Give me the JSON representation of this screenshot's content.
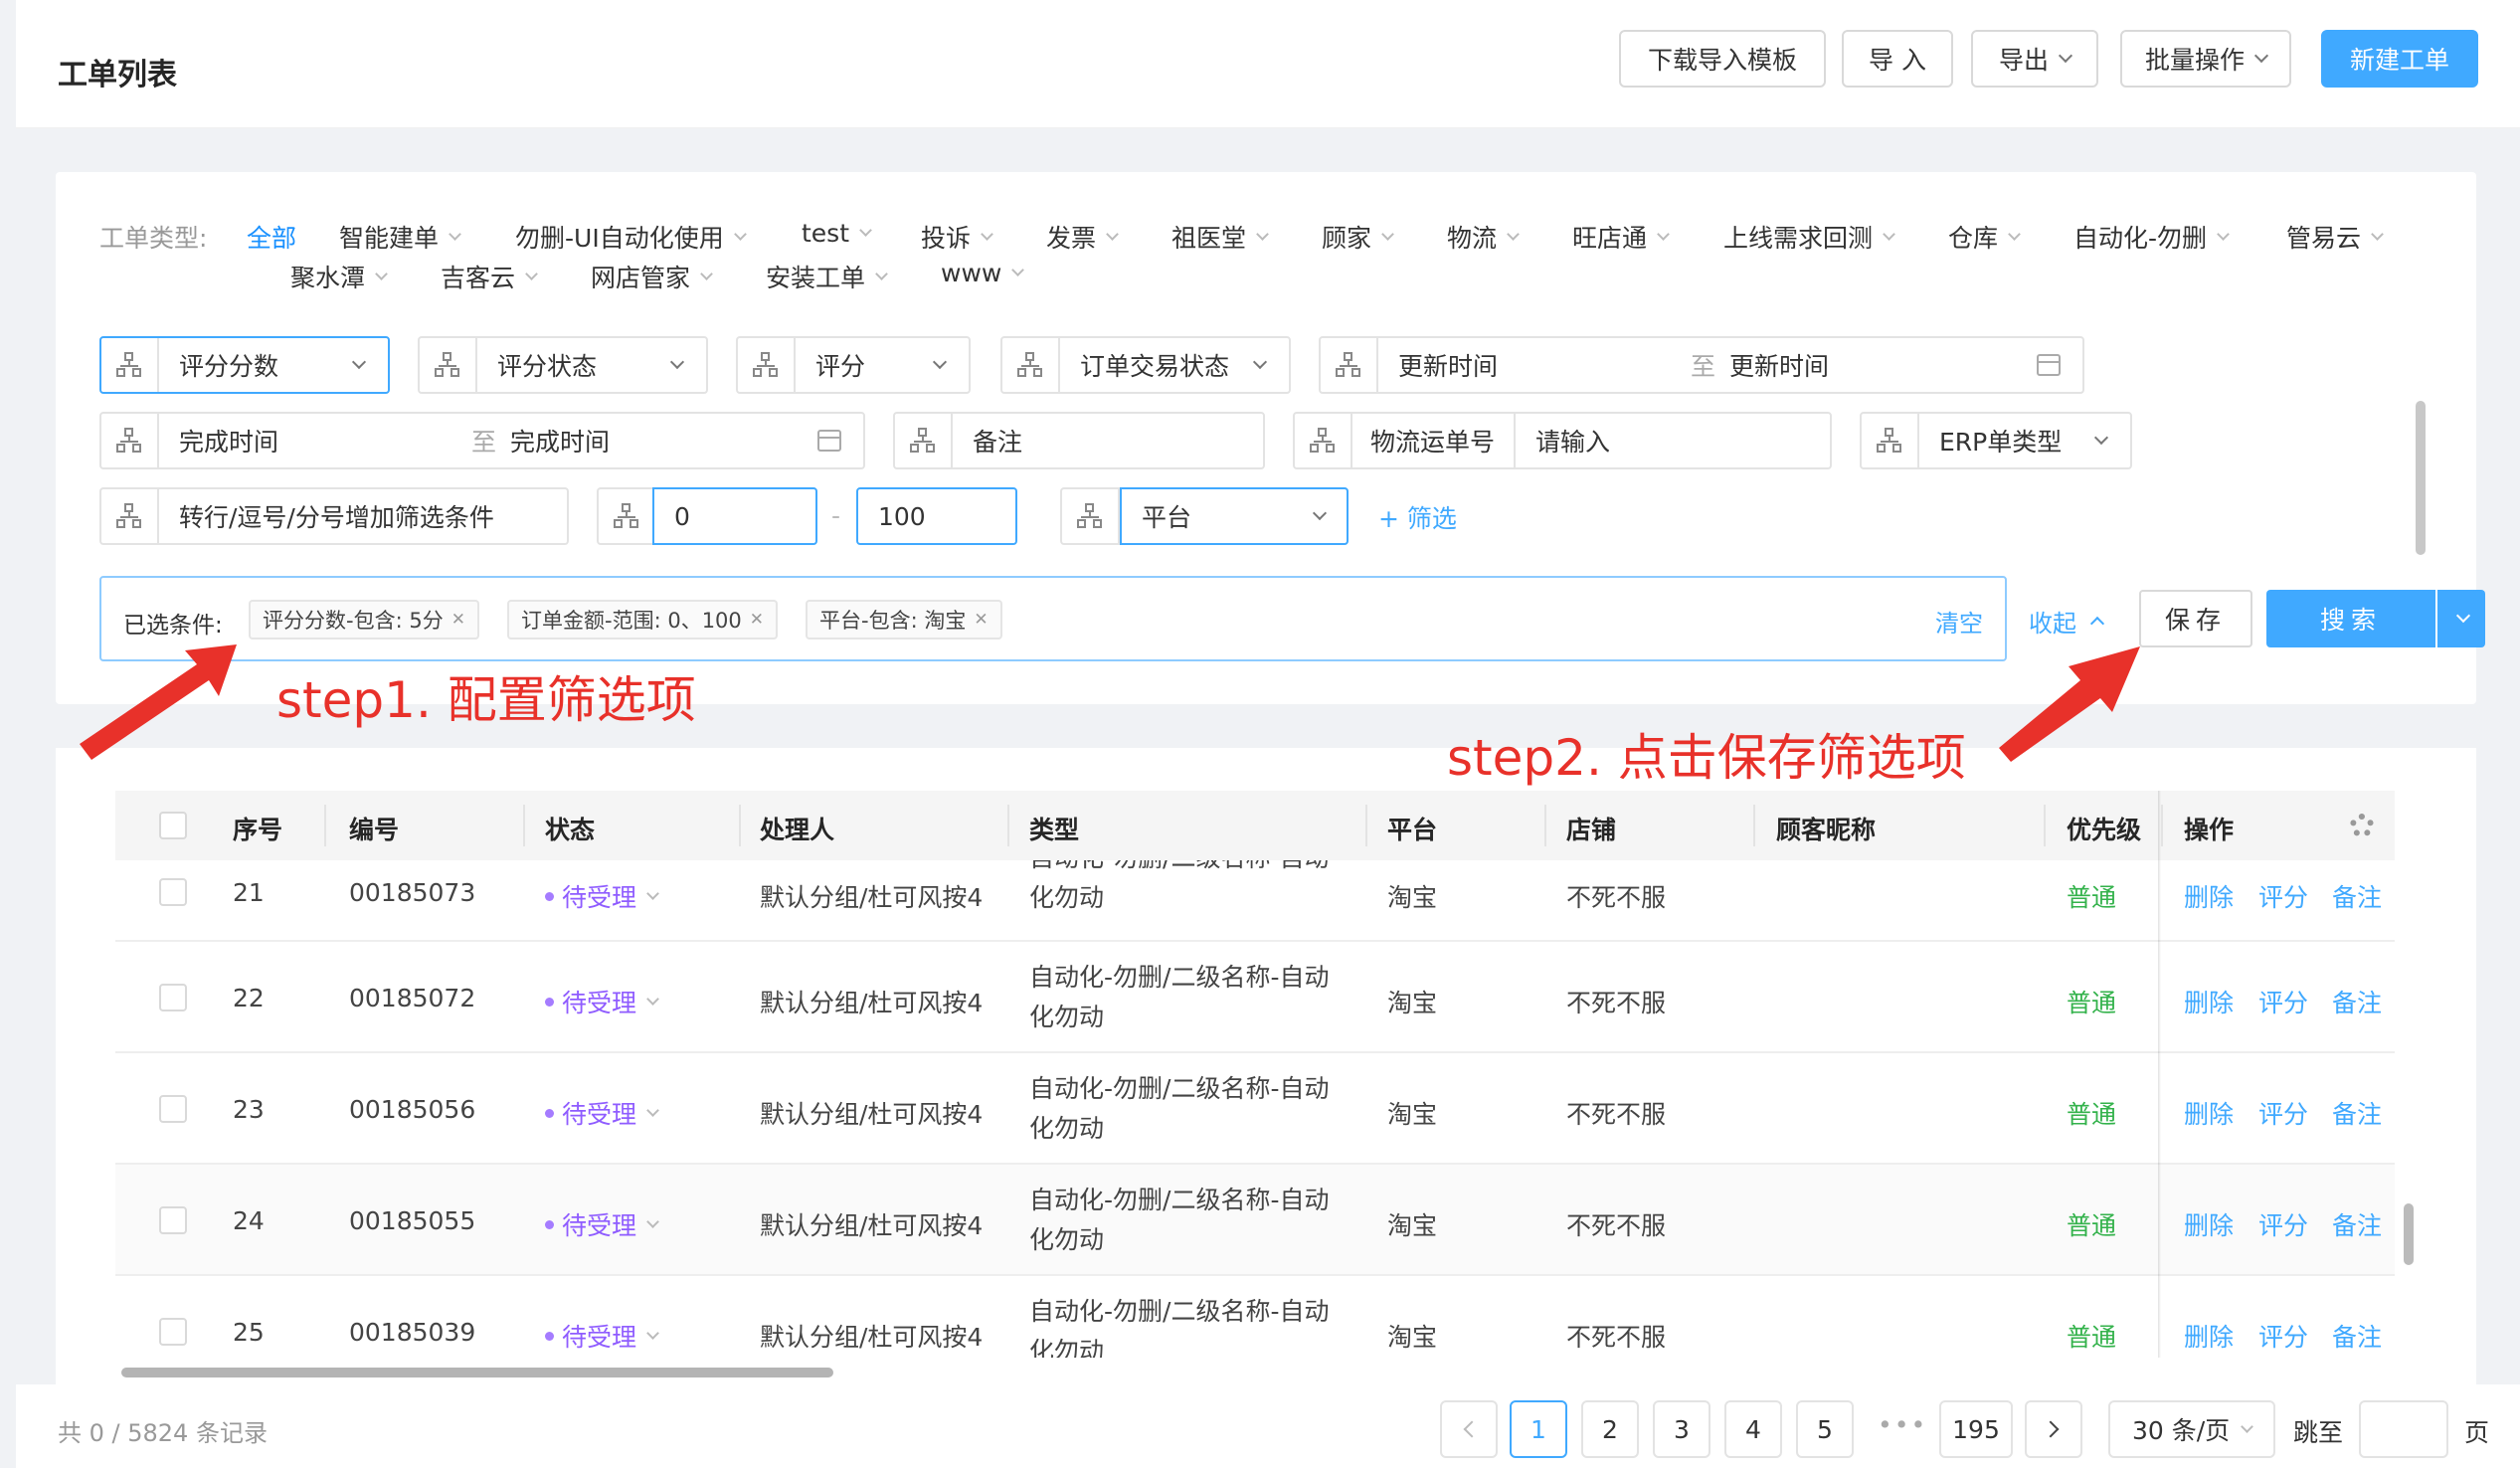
{
  "header": {
    "title": "工单列表",
    "buttons": {
      "download_template": "下载导入模板",
      "import": "导 入",
      "export": "导出",
      "batch": "批量操作",
      "create": "新建工单"
    }
  },
  "type_filter": {
    "label": "工单类型:",
    "row1": [
      "全部",
      "智能建单",
      "勿删-UI自动化使用",
      "test",
      "投诉",
      "发票",
      "祖医堂",
      "顾家",
      "物流",
      "旺店通",
      "上线需求回测",
      "仓库",
      "自动化-勿删",
      "管易云"
    ],
    "row2": [
      "聚水潭",
      "吉客云",
      "网店管家",
      "安装工单",
      "www"
    ]
  },
  "filters": {
    "score_count": "评分分数",
    "score_status": "评分状态",
    "score": "评分",
    "order_status": "订单交易状态",
    "update_start": "更新时间",
    "update_end": "更新时间",
    "range_sep": "至",
    "finish_start": "完成时间",
    "finish_end": "完成时间",
    "remark": "备注",
    "logistics_label": "物流运单号",
    "logistics_placeholder": "请输入",
    "erp_type": "ERP单类型",
    "split_tip": "转行/逗号/分号增加筛选条件",
    "amount_min": "0",
    "amount_sep": "-",
    "amount_max": "100",
    "platform": "平台",
    "add_filter": "+ 筛选"
  },
  "selected": {
    "label": "已选条件:",
    "tags": [
      "评分分数-包含: 5分",
      "订单金额-范围: 0、100",
      "平台-包含: 淘宝"
    ],
    "clear": "清空",
    "collapse": "收起",
    "save": "保存",
    "search": "搜索"
  },
  "annotations": {
    "step1": "step1. 配置筛选项",
    "step2": "step2. 点击保存筛选项"
  },
  "table": {
    "columns": [
      "序号",
      "编号",
      "状态",
      "处理人",
      "类型",
      "平台",
      "店铺",
      "顾客昵称",
      "优先级",
      "操作"
    ],
    "rows": [
      {
        "seq": "21",
        "id": "00185073",
        "status": "待受理",
        "handler": "默认分组/杜可风按4",
        "type1": "自动化-勿删/二级名称-自动",
        "type2": "化勿动",
        "platform": "淘宝",
        "shop": "不死不服",
        "nick": "",
        "priority": "普通"
      },
      {
        "seq": "22",
        "id": "00185072",
        "status": "待受理",
        "handler": "默认分组/杜可风按4",
        "type1": "自动化-勿删/二级名称-自动",
        "type2": "化勿动",
        "platform": "淘宝",
        "shop": "不死不服",
        "nick": "",
        "priority": "普通"
      },
      {
        "seq": "23",
        "id": "00185056",
        "status": "待受理",
        "handler": "默认分组/杜可风按4",
        "type1": "自动化-勿删/二级名称-自动",
        "type2": "化勿动",
        "platform": "淘宝",
        "shop": "不死不服",
        "nick": "",
        "priority": "普通"
      },
      {
        "seq": "24",
        "id": "00185055",
        "status": "待受理",
        "handler": "默认分组/杜可风按4",
        "type1": "自动化-勿删/二级名称-自动",
        "type2": "化勿动",
        "platform": "淘宝",
        "shop": "不死不服",
        "nick": "",
        "priority": "普通"
      },
      {
        "seq": "25",
        "id": "00185039",
        "status": "待受理",
        "handler": "默认分组/杜可风按4",
        "type1": "自动化-勿删/二级名称-自动",
        "type2": "化勿动",
        "platform": "淘宝",
        "shop": "不死不服",
        "nick": "",
        "priority": "普通"
      }
    ],
    "actions": {
      "delete": "删除",
      "rate": "评分",
      "note": "备注"
    }
  },
  "pagination": {
    "total": "共 0 / 5824 条记录",
    "pages": [
      "1",
      "2",
      "3",
      "4",
      "5"
    ],
    "ellipsis": "•••",
    "last": "195",
    "page_size": "30 条/页",
    "jump_label": "跳至",
    "jump_suffix": "页"
  },
  "colors": {
    "accent": "#40a9ff",
    "status": "#8f5cff",
    "priority": "#33b24b",
    "annotation": "#e8312a"
  },
  "icons": [
    "network-icon",
    "calendar-icon",
    "chevron-down-icon",
    "close-icon",
    "settings-icon",
    "chevron-left-icon",
    "chevron-right-icon"
  ]
}
